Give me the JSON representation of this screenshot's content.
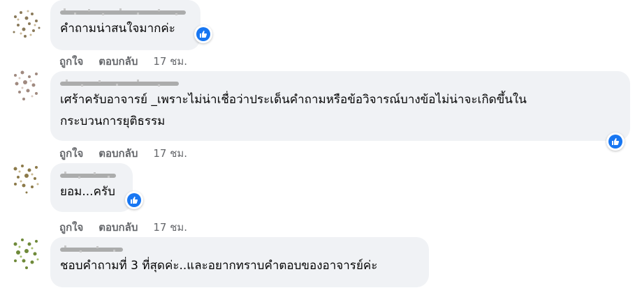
{
  "colors": {
    "bubble": "#f0f2f5",
    "text": "#050505",
    "meta": "#65676b",
    "like_blue": "#1877f2"
  },
  "icons": {
    "reaction": "like-thumbs-up-icon"
  },
  "comments": [
    {
      "author_blurred": true,
      "text": "คำถามน่าสนใจมากค่ะ",
      "reaction": "like",
      "actions": {
        "like": "ถูกใจ",
        "reply": "ตอบกลับ",
        "time": "17 ชม."
      }
    },
    {
      "author_blurred": true,
      "text": "เศร้าครับอาจารย์ _เพราะไม่น่าเชื่อว่าประเด็นคำถามหรือข้อวิจารณ์บางข้อไม่น่าจะเกิดขึ้นใน\nกระบวนการยุติธรรม",
      "reaction": "like",
      "actions": {
        "like": "ถูกใจ",
        "reply": "ตอบกลับ",
        "time": "17 ชม."
      }
    },
    {
      "author_blurred": true,
      "text": "ยอม...ครับ",
      "reaction": "like",
      "actions": {
        "like": "ถูกใจ",
        "reply": "ตอบกลับ",
        "time": "17 ชม."
      }
    },
    {
      "author_blurred": true,
      "text": "ชอบคำถามที่ 3 ที่สุดค่ะ..และอยากทราบคำตอบของอาจารย์ค่ะ",
      "reaction": null,
      "actions": null
    }
  ]
}
